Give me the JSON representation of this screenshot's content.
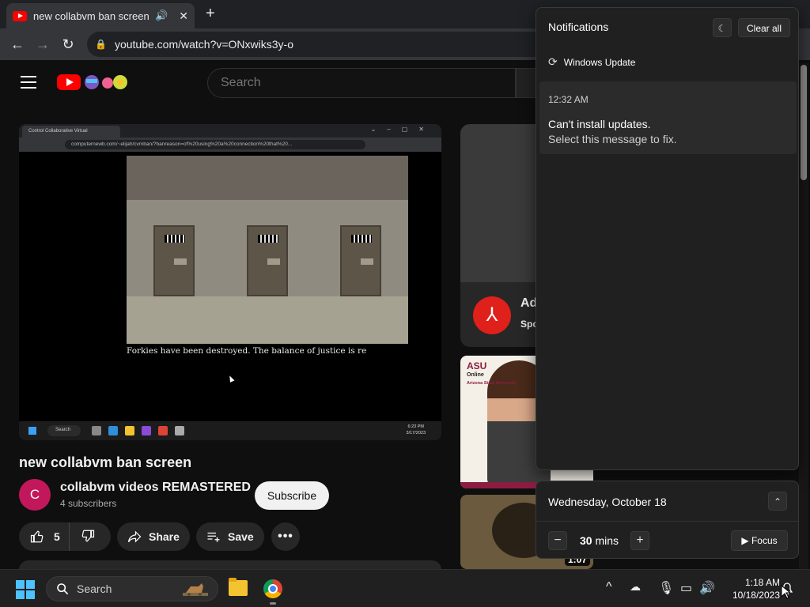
{
  "browser": {
    "tab_title": "new collabvm ban screen - YouTube",
    "url": "youtube.com/watch?v=ONxwiks3y-o"
  },
  "youtube": {
    "search_placeholder": "Search"
  },
  "player": {
    "inner_tab_title": "Control Collaborative Virtual",
    "inner_url": "computernewb.com/~elijah/cvmban/?banreason=of%20using%20a%20connection%20that%20...",
    "ban_message": "Forkies have been destroyed. The balance of justice is re",
    "inner_taskbar_search": "Search",
    "inner_clock_time": "6:23 PM",
    "inner_clock_date": "3/17/2023"
  },
  "video": {
    "title": "new collabvm ban screen",
    "channel_initial": "C",
    "channel_name": "collabvm videos REMASTERED",
    "subscribers": "4 subscribers",
    "subscribe_label": "Subscribe",
    "likes": "5",
    "share_label": "Share",
    "save_label": "Save"
  },
  "sidebar": {
    "ad_title": "Ad",
    "ad_sponsored": "Spo",
    "asu_logo": "ASU",
    "asu_online": "Online",
    "asu_university": "Arizona State University",
    "thumb2_duration": "1:07"
  },
  "notifications": {
    "title": "Notifications",
    "clear_all": "Clear all",
    "app_name": "Windows Update",
    "item": {
      "time": "12:32 AM",
      "heading": "Can't install updates.",
      "body": "Select this message to fix."
    }
  },
  "calendar": {
    "date": "Wednesday, October 18",
    "focus_minutes": "30",
    "minutes_unit": "mins",
    "focus_label": "Focus"
  },
  "taskbar": {
    "search_label": "Search",
    "time": "1:18 AM",
    "date": "10/18/2023"
  },
  "colors": {
    "youtube_red": "#ff0000",
    "avatar": "#c2185b",
    "windows_accent": "#4cc2ff"
  }
}
